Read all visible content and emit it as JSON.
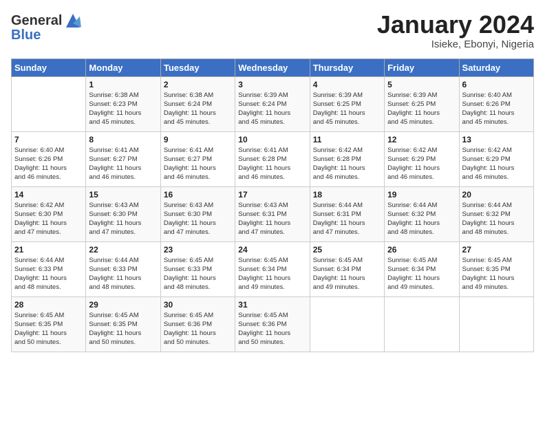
{
  "header": {
    "logo_general": "General",
    "logo_blue": "Blue",
    "month_title": "January 2024",
    "location": "Isieke, Ebonyi, Nigeria"
  },
  "calendar": {
    "days_of_week": [
      "Sunday",
      "Monday",
      "Tuesday",
      "Wednesday",
      "Thursday",
      "Friday",
      "Saturday"
    ],
    "weeks": [
      [
        {
          "day": "",
          "info": ""
        },
        {
          "day": "1",
          "info": "Sunrise: 6:38 AM\nSunset: 6:23 PM\nDaylight: 11 hours\nand 45 minutes."
        },
        {
          "day": "2",
          "info": "Sunrise: 6:38 AM\nSunset: 6:24 PM\nDaylight: 11 hours\nand 45 minutes."
        },
        {
          "day": "3",
          "info": "Sunrise: 6:39 AM\nSunset: 6:24 PM\nDaylight: 11 hours\nand 45 minutes."
        },
        {
          "day": "4",
          "info": "Sunrise: 6:39 AM\nSunset: 6:25 PM\nDaylight: 11 hours\nand 45 minutes."
        },
        {
          "day": "5",
          "info": "Sunrise: 6:39 AM\nSunset: 6:25 PM\nDaylight: 11 hours\nand 45 minutes."
        },
        {
          "day": "6",
          "info": "Sunrise: 6:40 AM\nSunset: 6:26 PM\nDaylight: 11 hours\nand 45 minutes."
        }
      ],
      [
        {
          "day": "7",
          "info": "Sunrise: 6:40 AM\nSunset: 6:26 PM\nDaylight: 11 hours\nand 46 minutes."
        },
        {
          "day": "8",
          "info": "Sunrise: 6:41 AM\nSunset: 6:27 PM\nDaylight: 11 hours\nand 46 minutes."
        },
        {
          "day": "9",
          "info": "Sunrise: 6:41 AM\nSunset: 6:27 PM\nDaylight: 11 hours\nand 46 minutes."
        },
        {
          "day": "10",
          "info": "Sunrise: 6:41 AM\nSunset: 6:28 PM\nDaylight: 11 hours\nand 46 minutes."
        },
        {
          "day": "11",
          "info": "Sunrise: 6:42 AM\nSunset: 6:28 PM\nDaylight: 11 hours\nand 46 minutes."
        },
        {
          "day": "12",
          "info": "Sunrise: 6:42 AM\nSunset: 6:29 PM\nDaylight: 11 hours\nand 46 minutes."
        },
        {
          "day": "13",
          "info": "Sunrise: 6:42 AM\nSunset: 6:29 PM\nDaylight: 11 hours\nand 46 minutes."
        }
      ],
      [
        {
          "day": "14",
          "info": "Sunrise: 6:42 AM\nSunset: 6:30 PM\nDaylight: 11 hours\nand 47 minutes."
        },
        {
          "day": "15",
          "info": "Sunrise: 6:43 AM\nSunset: 6:30 PM\nDaylight: 11 hours\nand 47 minutes."
        },
        {
          "day": "16",
          "info": "Sunrise: 6:43 AM\nSunset: 6:30 PM\nDaylight: 11 hours\nand 47 minutes."
        },
        {
          "day": "17",
          "info": "Sunrise: 6:43 AM\nSunset: 6:31 PM\nDaylight: 11 hours\nand 47 minutes."
        },
        {
          "day": "18",
          "info": "Sunrise: 6:44 AM\nSunset: 6:31 PM\nDaylight: 11 hours\nand 47 minutes."
        },
        {
          "day": "19",
          "info": "Sunrise: 6:44 AM\nSunset: 6:32 PM\nDaylight: 11 hours\nand 48 minutes."
        },
        {
          "day": "20",
          "info": "Sunrise: 6:44 AM\nSunset: 6:32 PM\nDaylight: 11 hours\nand 48 minutes."
        }
      ],
      [
        {
          "day": "21",
          "info": "Sunrise: 6:44 AM\nSunset: 6:33 PM\nDaylight: 11 hours\nand 48 minutes."
        },
        {
          "day": "22",
          "info": "Sunrise: 6:44 AM\nSunset: 6:33 PM\nDaylight: 11 hours\nand 48 minutes."
        },
        {
          "day": "23",
          "info": "Sunrise: 6:45 AM\nSunset: 6:33 PM\nDaylight: 11 hours\nand 48 minutes."
        },
        {
          "day": "24",
          "info": "Sunrise: 6:45 AM\nSunset: 6:34 PM\nDaylight: 11 hours\nand 49 minutes."
        },
        {
          "day": "25",
          "info": "Sunrise: 6:45 AM\nSunset: 6:34 PM\nDaylight: 11 hours\nand 49 minutes."
        },
        {
          "day": "26",
          "info": "Sunrise: 6:45 AM\nSunset: 6:34 PM\nDaylight: 11 hours\nand 49 minutes."
        },
        {
          "day": "27",
          "info": "Sunrise: 6:45 AM\nSunset: 6:35 PM\nDaylight: 11 hours\nand 49 minutes."
        }
      ],
      [
        {
          "day": "28",
          "info": "Sunrise: 6:45 AM\nSunset: 6:35 PM\nDaylight: 11 hours\nand 50 minutes."
        },
        {
          "day": "29",
          "info": "Sunrise: 6:45 AM\nSunset: 6:35 PM\nDaylight: 11 hours\nand 50 minutes."
        },
        {
          "day": "30",
          "info": "Sunrise: 6:45 AM\nSunset: 6:36 PM\nDaylight: 11 hours\nand 50 minutes."
        },
        {
          "day": "31",
          "info": "Sunrise: 6:45 AM\nSunset: 6:36 PM\nDaylight: 11 hours\nand 50 minutes."
        },
        {
          "day": "",
          "info": ""
        },
        {
          "day": "",
          "info": ""
        },
        {
          "day": "",
          "info": ""
        }
      ]
    ]
  }
}
